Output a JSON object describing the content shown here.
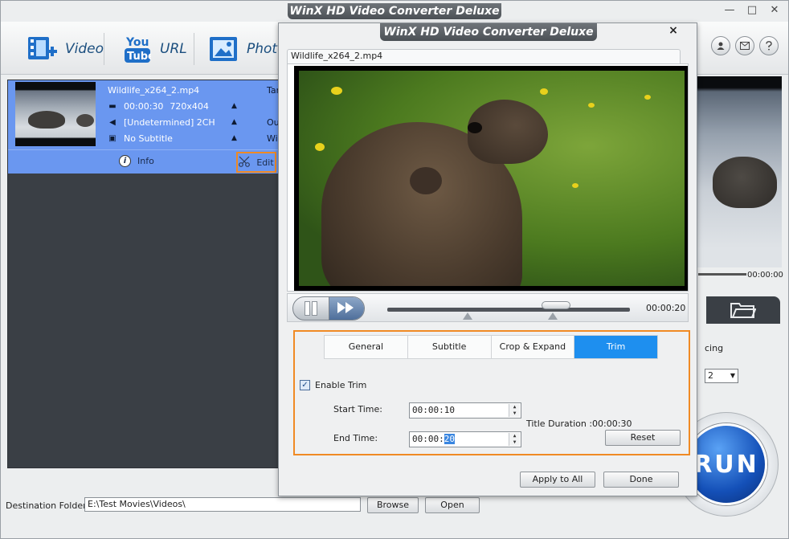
{
  "app": {
    "title": "WinX HD Video Converter Deluxe",
    "window_controls": [
      "—",
      "□",
      "✕"
    ]
  },
  "toolbar": {
    "video_label": "Video",
    "url_label": "URL",
    "photo_label": "Photo",
    "youtube_text_top": "You",
    "youtube_text_bottom": "Tube"
  },
  "top_icons": [
    "user-icon",
    "mail-icon",
    "help-icon"
  ],
  "file_item": {
    "name": "Wildlife_x264_2.mp4",
    "duration": "00:00:30",
    "resolution": "720x404",
    "audio": "[Undetermined] 2CH",
    "subtitle": "No Subtitle",
    "right_cut_1": "Tar",
    "right_cut_2": "Ou",
    "right_cut_3": "Wi",
    "info_label": "Info",
    "edit_label": "Edit"
  },
  "preview": {
    "time": "00:00:00"
  },
  "right_panel": {
    "deinterlacing_cut": "cing",
    "cpu_value": "2"
  },
  "run_label": "RUN",
  "bottom": {
    "dest_label": "Destination Folder:",
    "dest_value": "E:\\Test Movies\\Videos\\",
    "browse_label": "Browse",
    "open_label": "Open"
  },
  "dialog": {
    "title": "WinX HD Video Converter Deluxe",
    "close": "×",
    "clip_name": "Wildlife_x264_2.mp4",
    "video_time": "00:00:20",
    "tabs": [
      "General",
      "Subtitle",
      "Crop & Expand",
      "Trim"
    ],
    "active_tab": "Trim",
    "enable_trim_label": "Enable Trim",
    "enable_trim_checked": true,
    "start_time_label": "Start Time:",
    "start_time_value": "00:00:10",
    "end_time_label": "End Time:",
    "end_time_value_prefix": "00:00:",
    "end_time_value_selected": "20",
    "title_duration": "Title Duration :00:00:30",
    "reset_label": "Reset",
    "apply_label": "Apply to All",
    "done_label": "Done"
  }
}
